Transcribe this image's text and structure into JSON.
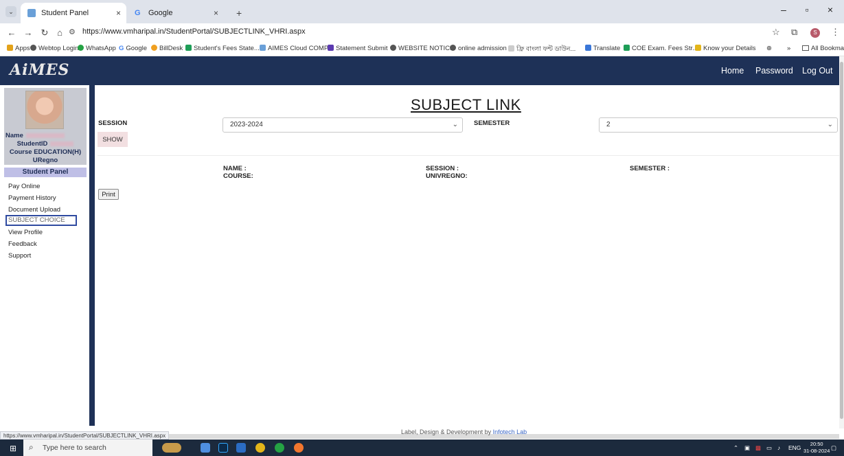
{
  "browser": {
    "tabs": [
      {
        "title": "Student Panel",
        "close": "×"
      },
      {
        "title": "Google",
        "close": "×"
      }
    ],
    "new_tab": "+",
    "window_controls": {
      "minimize": "–",
      "maximize": "▫",
      "close": "×"
    },
    "url": "https://www.vmharipal.in/StudentPortal/SUBJECTLINK_VHRI.aspx",
    "bookmarks": [
      "Apps",
      "Webtop Login",
      "WhatsApp",
      "Google",
      "BillDesk",
      "Student's Fees State...",
      "AIMES Cloud COMP...",
      "Statement Submit",
      "WEBSITE NOTICE",
      "online admission",
      "ফ্রি বাংলা ফন্ট ডাউন...",
      "Translate",
      "COE Exam. Fees Str...",
      "Know your Details"
    ],
    "bookmarks_overflow": "»",
    "all_bookmarks": "All Bookmarks",
    "status_url": "https://www.vmharipal.in/StudentPortal/SUBJECTLINK_VHRI.aspx",
    "profile_initial": "S"
  },
  "header": {
    "logo": "AiMES",
    "nav": [
      "Home",
      "Password",
      "Log Out"
    ]
  },
  "sidebar": {
    "name_label": "Name",
    "studentid_label": "StudentID",
    "course_label": "Course",
    "course_value": "EDUCATION(H)",
    "uregno_label": "URegno",
    "panel_heading": "Student Panel",
    "items": [
      "Pay Online",
      "Payment History",
      "Document Upload",
      "SUBJECT CHOICE",
      "View Profile",
      "Feedback",
      "Support"
    ]
  },
  "main": {
    "title": "SUBJECT LINK",
    "session_label": "SESSION",
    "session_value": "2023-2024",
    "semester_label": "SEMESTER",
    "semester_value": "2",
    "show_button": "SHOW",
    "info": {
      "name": "NAME :",
      "course": "COURSE:",
      "session": "SESSION :",
      "univregno": "UNIVREGNO:",
      "semester": "SEMESTER :"
    },
    "print_button": "Print"
  },
  "footer": {
    "text": "Label, Design & Development by",
    "link": "Infotech Lab"
  },
  "taskbar": {
    "search_placeholder": "Type here to search",
    "language": "ENG",
    "time": "20:50",
    "date": "31-08-2024"
  }
}
